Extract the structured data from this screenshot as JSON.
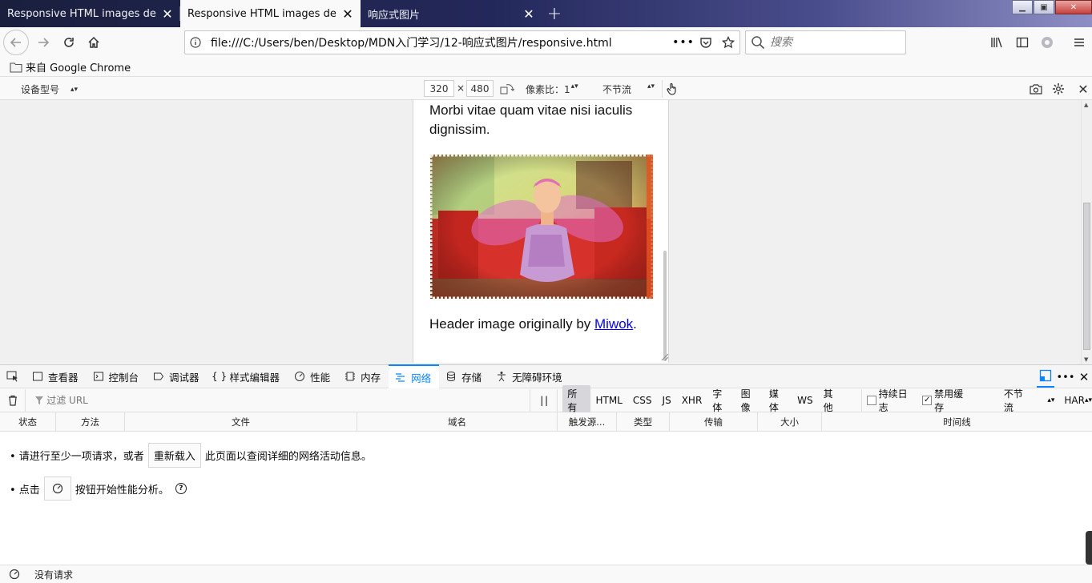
{
  "tabs": [
    {
      "title": "Responsive HTML images demo",
      "active": false
    },
    {
      "title": "Responsive HTML images demo",
      "active": true
    },
    {
      "title": "响应式图片",
      "active": false
    }
  ],
  "navbar": {
    "url": "file:///C:/Users/ben/Desktop/MDN入门学习/12-响应式图片/responsive.html",
    "search_placeholder": "搜索"
  },
  "bookmarks": {
    "folder_label": "来自 Google Chrome"
  },
  "rdm": {
    "device_label": "设备型号",
    "width": "320",
    "times": "×",
    "height": "480",
    "dpr_label": "像素比：1",
    "throttle_label": "不节流"
  },
  "page": {
    "paragraph_top": "Morbi vitae quam vitae nisi iaculis dignissim.",
    "caption_prefix": "Header image originally by ",
    "caption_link": "Miwok",
    "caption_suffix": "."
  },
  "devtools": {
    "tabs": [
      {
        "label": "查看器",
        "icon": "inspector-icon"
      },
      {
        "label": "控制台",
        "icon": "console-icon"
      },
      {
        "label": "调试器",
        "icon": "debugger-icon"
      },
      {
        "label": "样式编辑器",
        "icon": "style-editor-icon"
      },
      {
        "label": "性能",
        "icon": "performance-icon"
      },
      {
        "label": "内存",
        "icon": "memory-icon"
      },
      {
        "label": "网络",
        "icon": "network-icon",
        "selected": true
      },
      {
        "label": "存储",
        "icon": "storage-icon"
      },
      {
        "label": "无障碍环境",
        "icon": "accessibility-icon"
      }
    ],
    "network": {
      "filter_placeholder": "过滤 URL",
      "pause_label": "| |",
      "filter_types": [
        "所有",
        "HTML",
        "CSS",
        "JS",
        "XHR",
        "字体",
        "图像",
        "媒体",
        "WS",
        "其他"
      ],
      "persist_label": "持续日志",
      "persist_checked": false,
      "disable_cache_label": "禁用缓存",
      "disable_cache_checked": true,
      "throttle_label": "不节流",
      "har_label": "HAR"
    },
    "columns": [
      "状态",
      "方法",
      "文件",
      "域名",
      "触发源...",
      "类型",
      "传输",
      "大小",
      "时间线"
    ],
    "hints": {
      "line1_prefix": "• 请进行至少一项请求，或者",
      "reload_button": "重新载入",
      "line1_suffix": "此页面以查阅详细的网络活动信息。",
      "line2_prefix": "• 点击",
      "line2_suffix": "按钮开始性能分析。",
      "help_symbol": "?"
    },
    "status": {
      "text": "没有请求"
    }
  },
  "colors": {
    "accent": "#0a84ff",
    "link": "#0000ee"
  }
}
